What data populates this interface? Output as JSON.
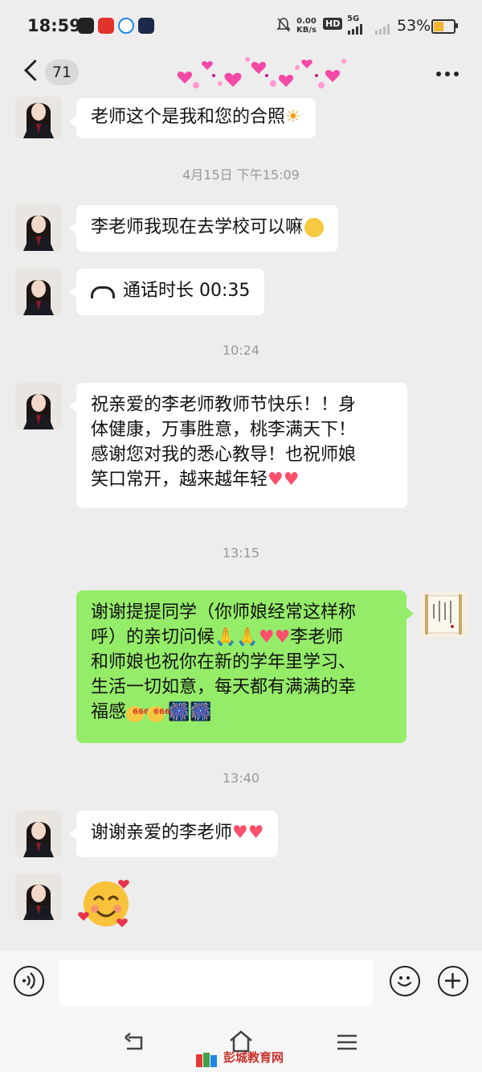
{
  "status_bar": {
    "time": "18:59",
    "net_speed_value": "0.00",
    "net_speed_unit": "KB/s",
    "hd_label": "HD",
    "network_type": "5G",
    "battery_percent": "53%",
    "battery_level": 0.53
  },
  "nav": {
    "unread_count": "71",
    "more_icon": "more-dots-icon",
    "back_icon": "chevron-left-icon"
  },
  "messages": {
    "m1_text": "老师这个是我和您的合照",
    "ts1": "4月15日 下午15:09",
    "m2_text": "李老师我现在去学校可以嘛",
    "m3_text": "通话时长 00:35",
    "ts2": "10:24",
    "m4_line1": "祝亲爱的李老师教师节快乐！！身",
    "m4_line2": "体健康，万事胜意，桃李满天下！",
    "m4_line3": "感谢您对我的悉心教导！也祝师娘",
    "m4_line4": "笑口常开，越来越年轻",
    "ts3": "13:15",
    "m5_line1": "谢谢提提同学（你师娘经常这样称",
    "m5_line2a": "呼）的亲切问候",
    "m5_line2b": "李老师",
    "m5_line3": "和师娘也祝你在新的学年里学习、",
    "m5_line4": "生活一切如意，每天都有满满的幸",
    "m5_line5": "福感",
    "ts4": "13:40",
    "m6_text": "谢谢亲爱的李老师"
  },
  "emoji": {
    "sun": "☀",
    "heart": "♥",
    "pray": "🙏",
    "six_label": "666",
    "firework": "🎆"
  },
  "avatar_calligraphy": "紅 塵 疾 風 起 人 生 本 莫 落",
  "watermark": "彭城教育网",
  "colors": {
    "my_bubble": "#95ec69",
    "their_bubble": "#ffffff",
    "background": "#ededed",
    "heart": "#ff4f6b"
  }
}
